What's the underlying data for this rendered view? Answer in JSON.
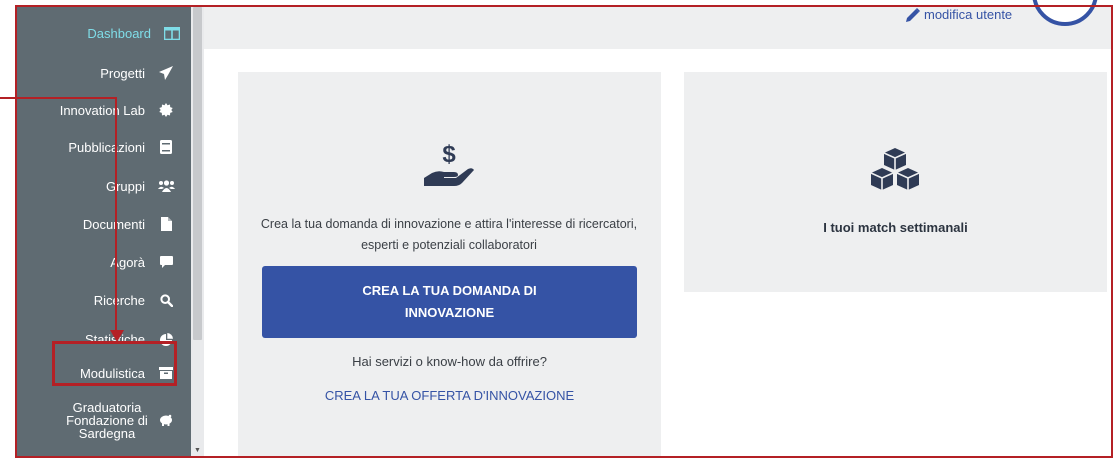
{
  "sidebar": {
    "items": [
      {
        "label": "Dashboard",
        "icon": "columns-icon",
        "active": true
      },
      {
        "label": "Progetti",
        "icon": "paper-plane-icon"
      },
      {
        "label": "Innovation Lab",
        "icon": "certificate-icon"
      },
      {
        "label": "Pubblicazioni",
        "icon": "book-icon"
      },
      {
        "label": "Gruppi",
        "icon": "users-icon"
      },
      {
        "label": "Documenti",
        "icon": "file-icon"
      },
      {
        "label": "Agorà",
        "icon": "comment-icon"
      },
      {
        "label": "Ricerche",
        "icon": "search-icon"
      },
      {
        "label": "Statistiche",
        "icon": "pie-chart-icon"
      },
      {
        "label": "Modulistica",
        "icon": "archive-icon"
      },
      {
        "label": "Graduatoria Fondazione di Sardegna",
        "icon": "piggy-bank-icon"
      }
    ]
  },
  "header": {
    "user_link": "modifica utente"
  },
  "card_innovation": {
    "icon": "hand-dollar-icon",
    "description": "Crea la tua domanda di innovazione e attira l'interesse di ricercatori, esperti e potenziali collaboratori",
    "cta_label": "CREA LA TUA DOMANDA DI INNOVAZIONE",
    "question": "Hai servizi o know-how da offrire?",
    "offer_link": "CREA LA TUA OFFERTA D'INNOVAZIONE"
  },
  "card_matches": {
    "icon": "cubes-icon",
    "title": "I tuoi match settimanali"
  },
  "colors": {
    "sidebar_bg": "#5f6b72",
    "active_label": "#7fdde8",
    "brand_blue": "#3553a5",
    "annotation_red": "#b42025",
    "card_bg": "#eeeff0"
  }
}
